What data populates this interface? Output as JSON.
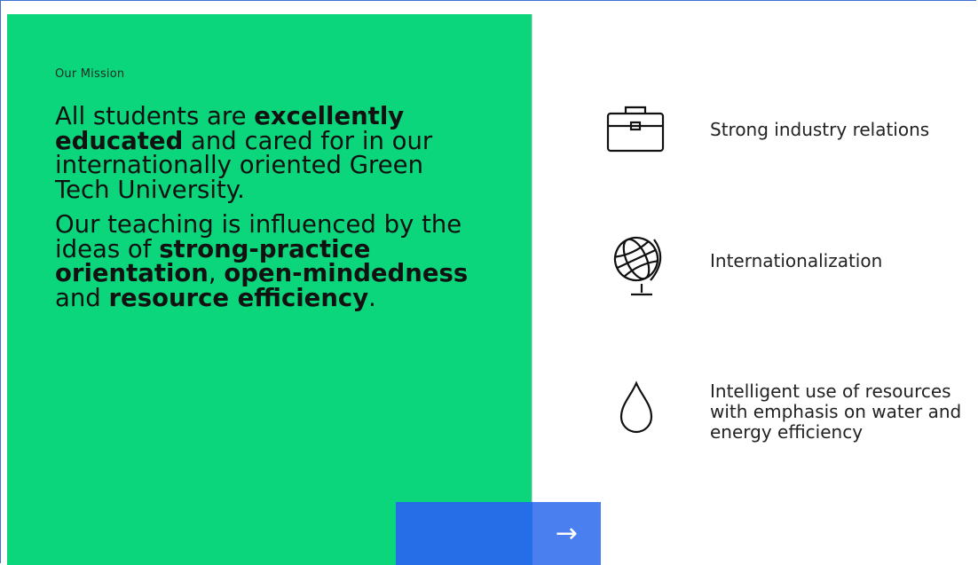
{
  "mission": {
    "eyebrow": "Our Mission",
    "paragraph1": {
      "t1": "All students are ",
      "b1": "excellently educated",
      "t2": " and cared for in our internationally oriented Green Tech University."
    },
    "paragraph2": {
      "t1": "Our teaching is influenced by the ideas of ",
      "b1": "strong-practice orientation",
      "t2": ", ",
      "b2": "open-mindedness",
      "t3": " and ",
      "b3": "resource efficiency",
      "t4": "."
    }
  },
  "features": [
    {
      "icon": "briefcase-icon",
      "label": "Strong industry relations"
    },
    {
      "icon": "globe-icon",
      "label": "Internationalization"
    },
    {
      "icon": "water-drop-icon",
      "label": "Intelligent use of resources with emphasis on water and energy efficiency"
    }
  ],
  "nav": {
    "next_arrow": "→"
  },
  "colors": {
    "green": "#0bd67c",
    "blue": "#266ee8",
    "blue_light": "#4a7ff0"
  }
}
